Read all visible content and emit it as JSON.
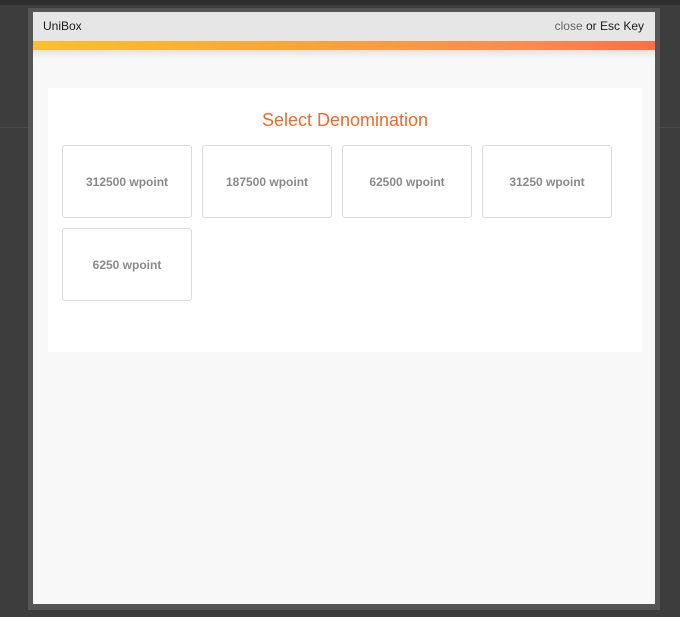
{
  "header": {
    "title": "UniBox",
    "close_link": "close",
    "close_hint": " or Esc Key"
  },
  "panel": {
    "title": "Select Denomination",
    "denominations": [
      "312500 wpoint",
      "187500 wpoint",
      "62500 wpoint",
      "31250 wpoint",
      "6250 wpoint"
    ]
  },
  "colors": {
    "title_accent": "#ee6a2a",
    "gradient_start": "#fbc02d",
    "gradient_end": "#ff7043"
  }
}
